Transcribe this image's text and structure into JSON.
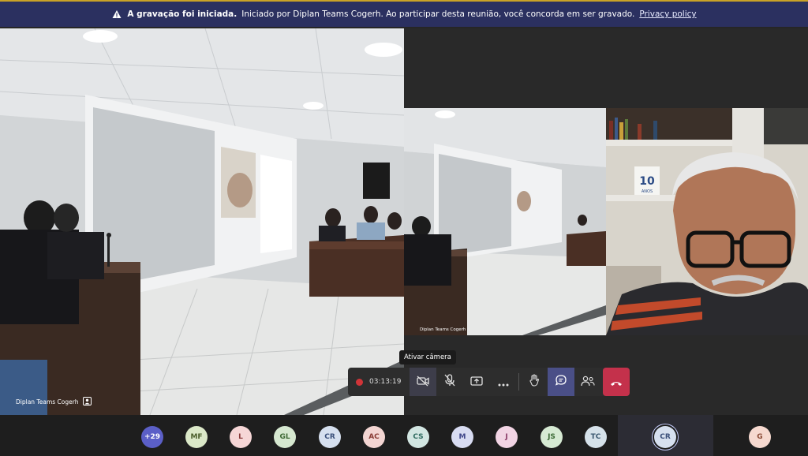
{
  "banner": {
    "bold_text": "A gravação foi iniciada.",
    "text": "Iniciado por Diplan Teams Cogerh. Ao participar desta reunião, você concorda em ser gravado.",
    "link": "Privacy policy"
  },
  "tiles": {
    "main_name": "Diplan Teams Cogerh",
    "screen_name": "Diplan Teams Cogerh",
    "poster_text": "10 ANOS"
  },
  "controls": {
    "timer": "03:13:19",
    "tooltip": "Ativar câmera"
  },
  "participants": [
    {
      "initials": "+29",
      "bg": "#5b5fc7",
      "fg": "#ffffff"
    },
    {
      "initials": "MF",
      "bg": "#dbe8c8",
      "fg": "#4b5e2b"
    },
    {
      "initials": "L",
      "bg": "#f6d6d6",
      "fg": "#8a3a3a"
    },
    {
      "initials": "GL",
      "bg": "#d6e8d0",
      "fg": "#3e6a35"
    },
    {
      "initials": "CR",
      "bg": "#d6e0ef",
      "fg": "#3a4f7a"
    },
    {
      "initials": "AC",
      "bg": "#f3d5d2",
      "fg": "#8a3c35"
    },
    {
      "initials": "CS",
      "bg": "#d2e6e2",
      "fg": "#2f6b60"
    },
    {
      "initials": "M",
      "bg": "#d8dcf2",
      "fg": "#40478a"
    },
    {
      "initials": "J",
      "bg": "#f2d4e4",
      "fg": "#8a3a66"
    },
    {
      "initials": "JS",
      "bg": "#d6ead3",
      "fg": "#3d6b37"
    },
    {
      "initials": "TC",
      "bg": "#d6e2ea",
      "fg": "#3b5870"
    },
    {
      "initials": "CR",
      "bg": "#d6e0ef",
      "fg": "#3a4f7a"
    },
    {
      "initials": "G",
      "bg": "#f6d9cf",
      "fg": "#8a4a35"
    }
  ]
}
